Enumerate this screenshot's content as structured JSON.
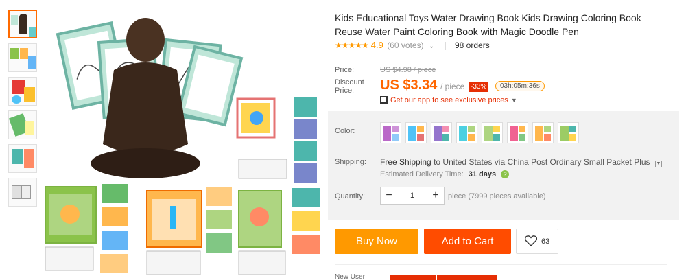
{
  "product": {
    "title": "Kids Educational Toys Water Drawing Book Kids Drawing Coloring Book Reuse Water Paint Coloring Book with Magic Doodle Pen",
    "rating": {
      "stars": "★★★★★",
      "score": "4.9",
      "votes": "(60 votes)"
    },
    "orders": "98 orders"
  },
  "price": {
    "label": "Price:",
    "original": "US $4.98 / piece",
    "discount_label_1": "Discount",
    "discount_label_2": "Price:",
    "current": "US $3.34",
    "unit": "/ piece",
    "discount_badge": "-33%",
    "timer": "03h:05m:36s",
    "app_promo": "Get our app to see exclusive prices"
  },
  "color": {
    "label": "Color:",
    "swatch_count": 8
  },
  "shipping": {
    "label": "Shipping:",
    "free": "Free Shipping",
    "to": "to",
    "destination": "United States via China Post Ordinary Small Packet Plus",
    "estimated_label": "Estimated Delivery Time:",
    "estimated_days": "31 days"
  },
  "quantity": {
    "label": "Quantity:",
    "minus": "−",
    "value": "1",
    "plus": "+",
    "available": "piece (7999 pieces available)"
  },
  "actions": {
    "buy_now": "Buy Now",
    "add_to_cart": "Add to Cart",
    "wishlist_count": "63"
  },
  "footer": {
    "new_user": "New User"
  },
  "colors": {
    "accent_orange": "#ff9900",
    "cart_orange": "#ff4c00",
    "price_orange": "#ff6600",
    "discount_red": "#e62e04"
  }
}
